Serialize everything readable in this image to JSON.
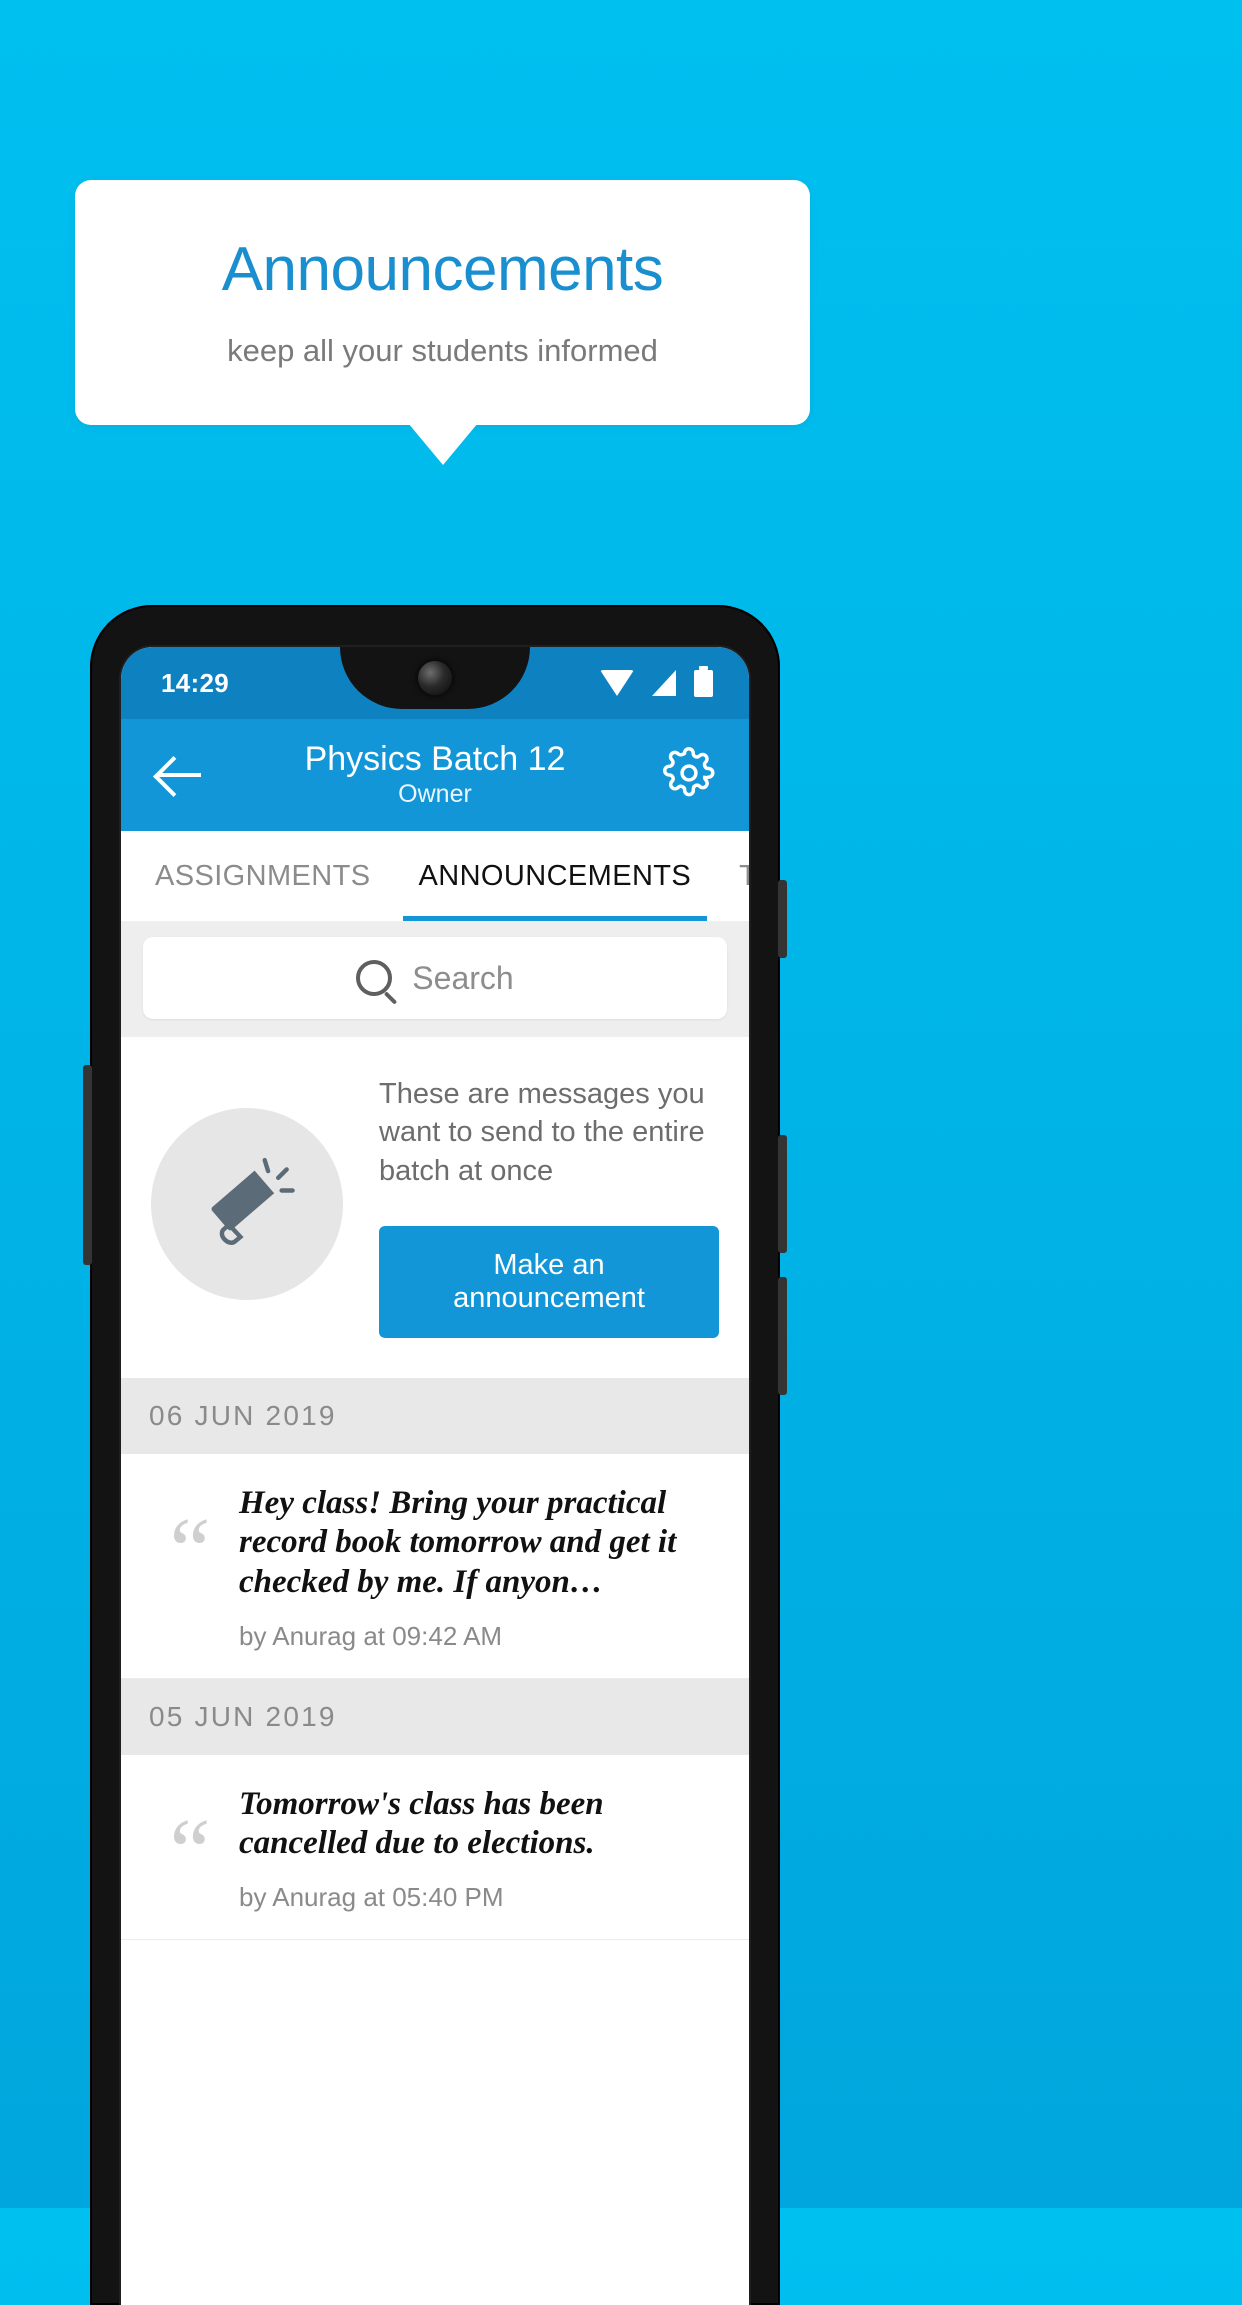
{
  "promo": {
    "title": "Announcements",
    "subtitle": "keep all your students informed",
    "title_color": "#1a8fd0",
    "background_color": "#00b5e8"
  },
  "phone": {
    "statusbar": {
      "time": "14:29",
      "icons": [
        "wifi-icon",
        "signal-icon",
        "battery-icon"
      ]
    },
    "appbar": {
      "back_icon": "back-arrow-icon",
      "title": "Physics Batch 12",
      "subtitle": "Owner",
      "settings_icon": "gear-icon",
      "color": "#1296d8"
    },
    "tabs": [
      {
        "label": "ASSIGNMENTS",
        "active": false
      },
      {
        "label": "ANNOUNCEMENTS",
        "active": true
      },
      {
        "label": "TESTS",
        "active": false
      },
      {
        "label": "’",
        "active": false
      }
    ],
    "search": {
      "icon": "search-icon",
      "placeholder": "Search",
      "value": ""
    },
    "empty_promo": {
      "icon": "megaphone-icon",
      "text": "These are messages you want to send to the entire batch at once",
      "button_label": "Make an announcement"
    },
    "announcements": [
      {
        "date": "06  JUN  2019",
        "items": [
          {
            "quote_icon": "quote-icon",
            "text": "Hey class! Bring your practical record book tomorrow and get it checked by me. If anyon…",
            "meta": "by Anurag at 09:42 AM"
          }
        ]
      },
      {
        "date": "05  JUN  2019",
        "items": [
          {
            "quote_icon": "quote-icon",
            "text": "Tomorrow's class has been cancelled due to elections.",
            "meta": "by Anurag at 05:40 PM"
          }
        ]
      }
    ]
  }
}
